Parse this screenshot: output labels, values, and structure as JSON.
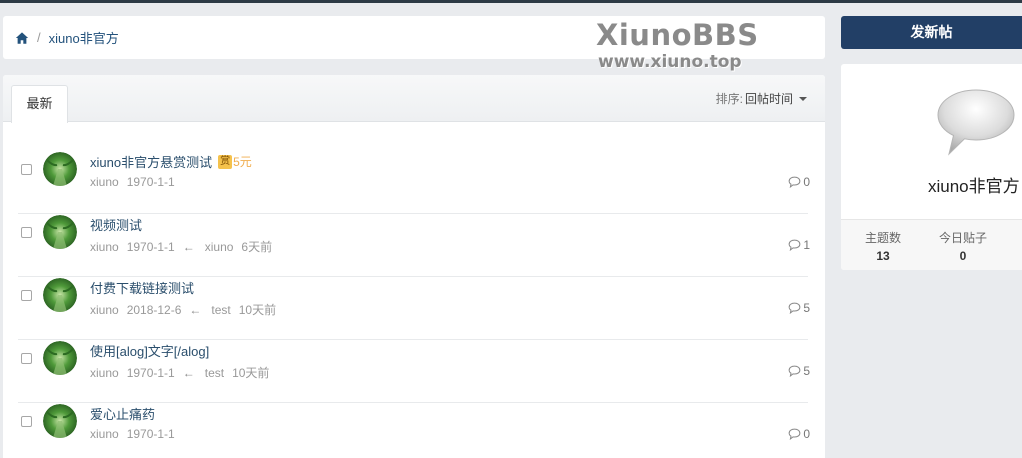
{
  "breadcrumb": {
    "home_icon": "home-icon",
    "separator": "/",
    "forum": "xiuno非官方"
  },
  "watermark": {
    "title": "XiunoBBS",
    "url": "www.xiuno.top"
  },
  "tabs": [
    {
      "label": "最新"
    }
  ],
  "sort": {
    "label": "排序:",
    "value": "回帖时间"
  },
  "threads": [
    {
      "title": "xiuno非官方悬赏测试",
      "reward_icon": "赏",
      "reward_amount": "5元",
      "author": "xiuno",
      "date": "1970-1-1",
      "arrow": "",
      "last_user": "",
      "last_time": "",
      "replies": "0"
    },
    {
      "title": "视频测试",
      "reward_icon": "",
      "reward_amount": "",
      "author": "xiuno",
      "date": "1970-1-1",
      "arrow": "←",
      "last_user": "xiuno",
      "last_time": "6天前",
      "replies": "1"
    },
    {
      "title": "付费下载链接测试",
      "reward_icon": "",
      "reward_amount": "",
      "author": "xiuno",
      "date": "2018-12-6",
      "arrow": "←",
      "last_user": "test",
      "last_time": "10天前",
      "replies": "5"
    },
    {
      "title": "使用[alog]文字[/alog]",
      "reward_icon": "",
      "reward_amount": "",
      "author": "xiuno",
      "date": "1970-1-1",
      "arrow": "←",
      "last_user": "test",
      "last_time": "10天前",
      "replies": "5"
    },
    {
      "title": "爱心止痛药",
      "reward_icon": "",
      "reward_amount": "",
      "author": "xiuno",
      "date": "1970-1-1",
      "arrow": "",
      "last_user": "",
      "last_time": "",
      "replies": "0"
    }
  ],
  "sidebar": {
    "new_post_label": "发新帖",
    "forum_icon": "speech-bubble-icon",
    "forum_name": "xiuno非官方",
    "stats": [
      {
        "label": "主题数",
        "value": "13"
      },
      {
        "label": "今日贴子",
        "value": "0"
      }
    ]
  },
  "colors": {
    "primary": "#223f66",
    "link": "#2a4e6c",
    "reward": "#f0ad4e",
    "topbar": "#2d3a45"
  }
}
